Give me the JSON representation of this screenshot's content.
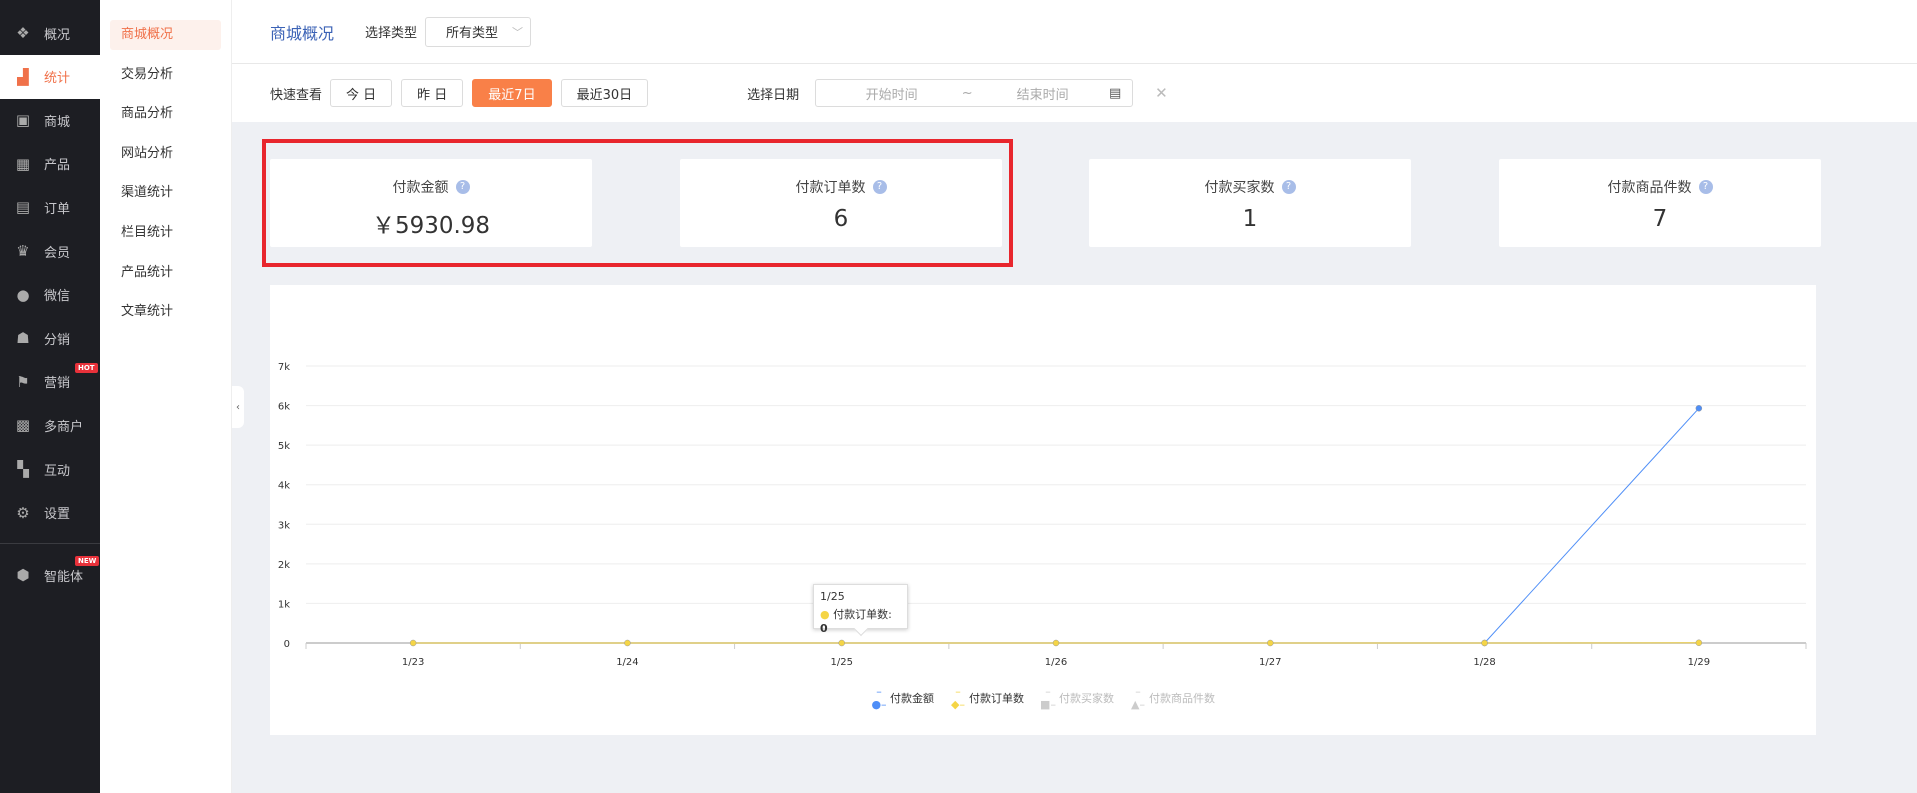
{
  "sidebar": {
    "items": [
      {
        "label": "概况",
        "icon": "layers-icon"
      },
      {
        "label": "统计",
        "icon": "chart-icon",
        "active": true
      },
      {
        "label": "商城",
        "icon": "mall-icon"
      },
      {
        "label": "产品",
        "icon": "grid-icon"
      },
      {
        "label": "订单",
        "icon": "clipboard-icon"
      },
      {
        "label": "会员",
        "icon": "crown-icon"
      },
      {
        "label": "微信",
        "icon": "wechat-icon"
      },
      {
        "label": "分销",
        "icon": "users-icon"
      },
      {
        "label": "营销",
        "icon": "flag-icon",
        "badge": "HOT"
      },
      {
        "label": "多商户",
        "icon": "store-icon"
      },
      {
        "label": "互动",
        "icon": "interaction-icon"
      },
      {
        "label": "设置",
        "icon": "gear-icon"
      },
      {
        "label": "智能体",
        "icon": "cube-icon",
        "badge": "NEW"
      }
    ]
  },
  "subnav": {
    "items": [
      "商城概况",
      "交易分析",
      "商品分析",
      "网站分析",
      "渠道统计",
      "栏目统计",
      "产品统计",
      "文章统计"
    ]
  },
  "header": {
    "title": "商城概况",
    "type_label": "选择类型",
    "type_value": "所有类型"
  },
  "filter": {
    "quick_label": "快速查看",
    "buttons": [
      "今 日",
      "昨 日",
      "最近7日",
      "最近30日"
    ],
    "active": 2,
    "date_label": "选择日期",
    "start_placeholder": "开始时间",
    "sep": "~",
    "end_placeholder": "结束时间"
  },
  "cards": [
    {
      "title": "付款金额",
      "value": "￥5930.98"
    },
    {
      "title": "付款订单数",
      "value": "6"
    },
    {
      "title": "付款买家数",
      "value": "1"
    },
    {
      "title": "付款商品件数",
      "value": "7"
    }
  ],
  "chart_data": {
    "type": "line",
    "categories": [
      "1/23",
      "1/24",
      "1/25",
      "1/26",
      "1/27",
      "1/28",
      "1/29"
    ],
    "ylim": [
      0,
      7000
    ],
    "yticks": [
      "0",
      "1k",
      "2k",
      "3k",
      "4k",
      "5k",
      "6k",
      "7k"
    ],
    "series": [
      {
        "name": "付款金额",
        "color": "#4e8ef7",
        "values": [
          null,
          null,
          null,
          null,
          null,
          0,
          5930.98
        ],
        "visible": true
      },
      {
        "name": "付款订单数",
        "color": "#f5d546",
        "values": [
          0,
          0,
          0,
          0,
          0,
          0,
          6
        ],
        "visible": true
      },
      {
        "name": "付款买家数",
        "color": "#cccccc",
        "visible": false
      },
      {
        "name": "付款商品件数",
        "color": "#cccccc",
        "visible": false
      }
    ],
    "tooltip": {
      "title": "1/25",
      "series": "付款订单数",
      "value": "0"
    }
  }
}
